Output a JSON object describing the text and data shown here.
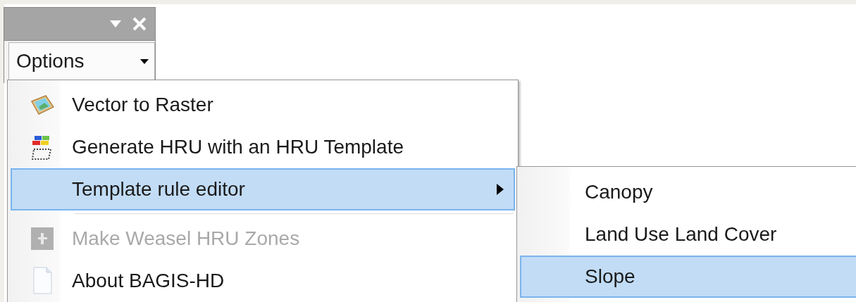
{
  "toolbar": {
    "button": "Options"
  },
  "menu": {
    "items": [
      {
        "kind": "item",
        "label": "Vector to Raster",
        "selected": false,
        "disabled": false,
        "has_submenu": false
      },
      {
        "kind": "item",
        "label": "Generate HRU with an HRU Template",
        "selected": false,
        "disabled": false,
        "has_submenu": false
      },
      {
        "kind": "item",
        "label": "Template rule editor",
        "selected": true,
        "disabled": false,
        "has_submenu": true
      },
      {
        "kind": "separator"
      },
      {
        "kind": "item",
        "label": "Make Weasel HRU Zones",
        "selected": false,
        "disabled": true,
        "has_submenu": false
      },
      {
        "kind": "item",
        "label": "About BAGIS-HD",
        "selected": false,
        "disabled": false,
        "has_submenu": false
      }
    ]
  },
  "submenu": {
    "items": [
      {
        "label": "Canopy",
        "selected": false
      },
      {
        "label": "Land Use Land Cover",
        "selected": false
      },
      {
        "label": "Slope",
        "selected": true
      }
    ]
  }
}
